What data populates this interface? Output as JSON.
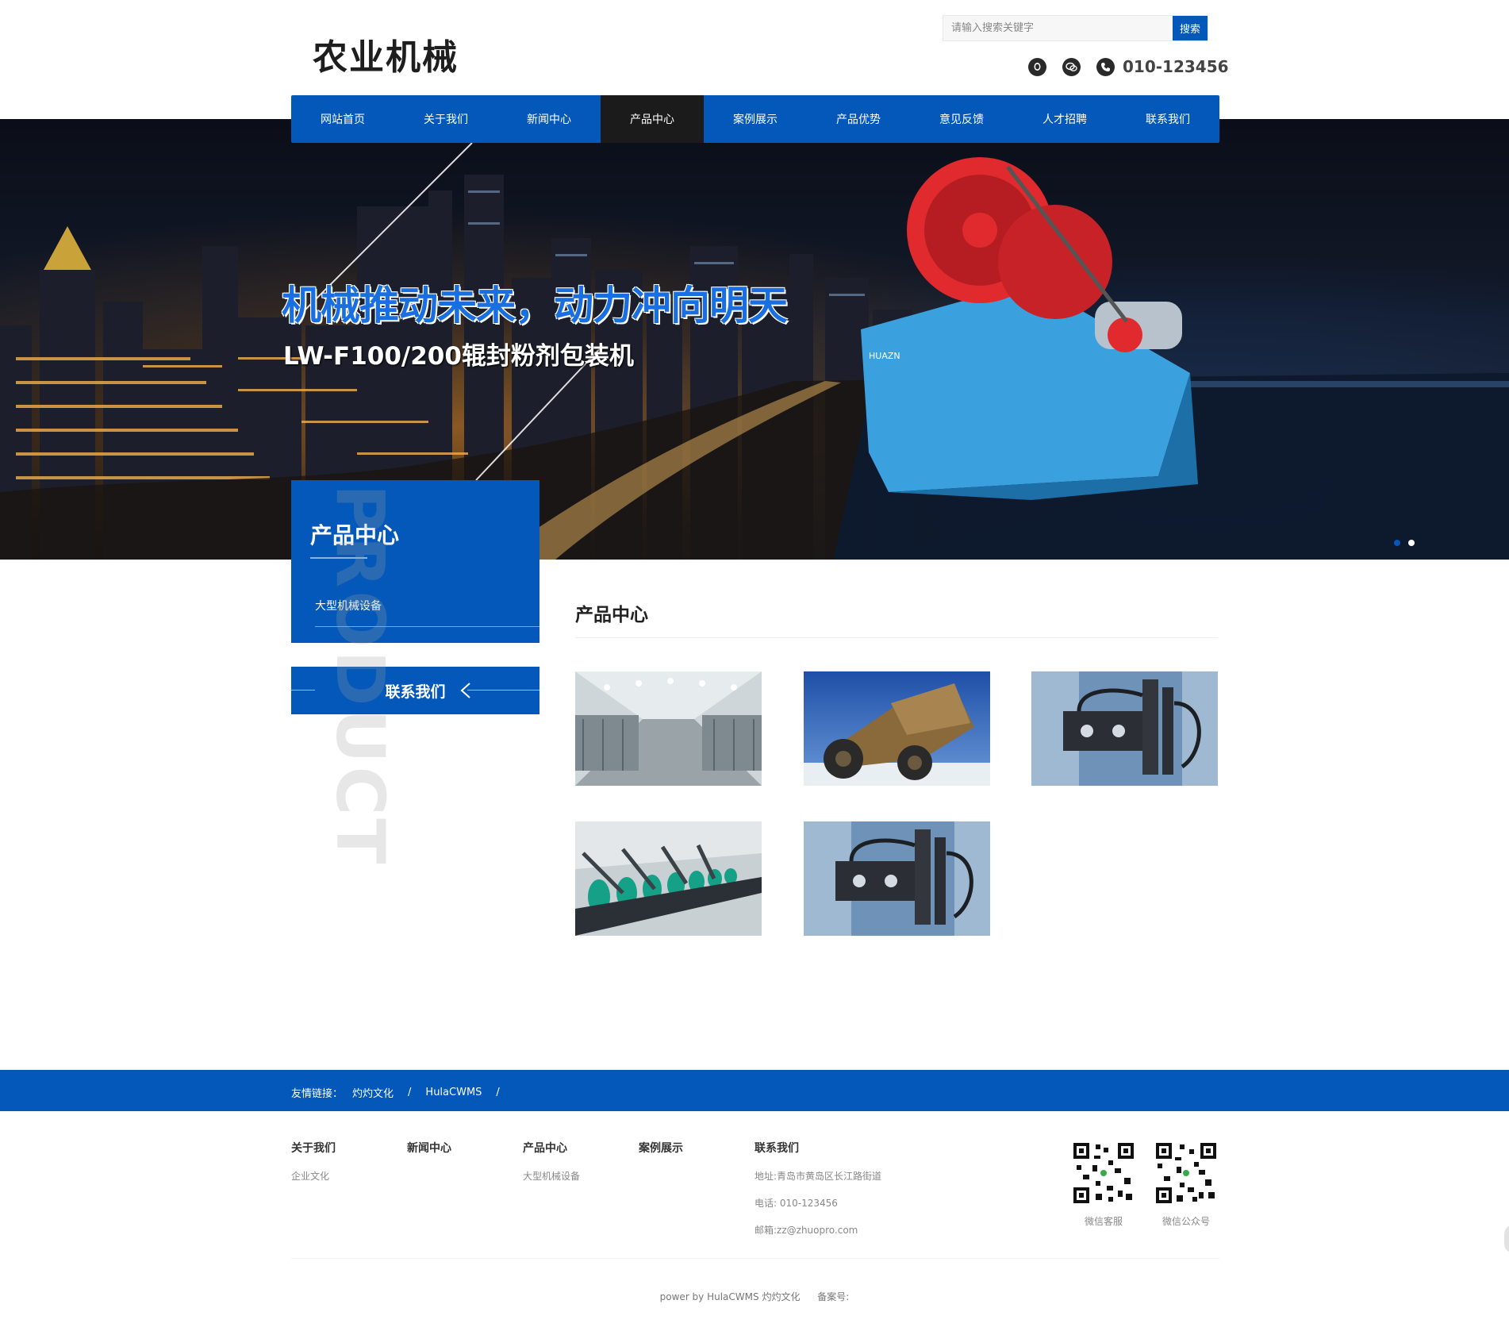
{
  "header": {
    "logo": "农业机械",
    "search_placeholder": "请输入搜索关键字",
    "search_button": "搜索",
    "phone": "010-123456"
  },
  "nav": {
    "items": [
      "网站首页",
      "关于我们",
      "新闻中心",
      "产品中心",
      "案例展示",
      "产品优势",
      "意见反馈",
      "人才招聘",
      "联系我们"
    ]
  },
  "banner": {
    "title": "机械推动未来，动力冲向明天",
    "subtitle": "LW-F100/200辊封粉剂包装机",
    "machine_brand": "HUAZN"
  },
  "sidebar": {
    "title": "产品中心",
    "watermark": "PRODUCT",
    "items": [
      "大型机械设备"
    ],
    "contact": "联系我们"
  },
  "main": {
    "title": "产品中心"
  },
  "footer": {
    "friend_label": "友情链接：",
    "friend_links": [
      "灼灼文化",
      "HulaCWMS"
    ],
    "columns": [
      {
        "title": "关于我们",
        "items": [
          "企业文化"
        ]
      },
      {
        "title": "新闻中心",
        "items": []
      },
      {
        "title": "产品中心",
        "items": [
          "大型机械设备"
        ]
      },
      {
        "title": "案例展示",
        "items": []
      },
      {
        "title": "联系我们",
        "items": [
          "地址:青岛市黄岛区长江路街道",
          "电话: 010-123456",
          "邮箱:zz@zhuopro.com"
        ]
      }
    ],
    "qr": [
      "微信客服",
      "微信公众号"
    ],
    "powered": "power by HulaCWMS 灼灼文化",
    "icp": "备案号:"
  },
  "colors": {
    "brand_blue": "#0358b9",
    "nav_active": "#1b1b1b"
  }
}
